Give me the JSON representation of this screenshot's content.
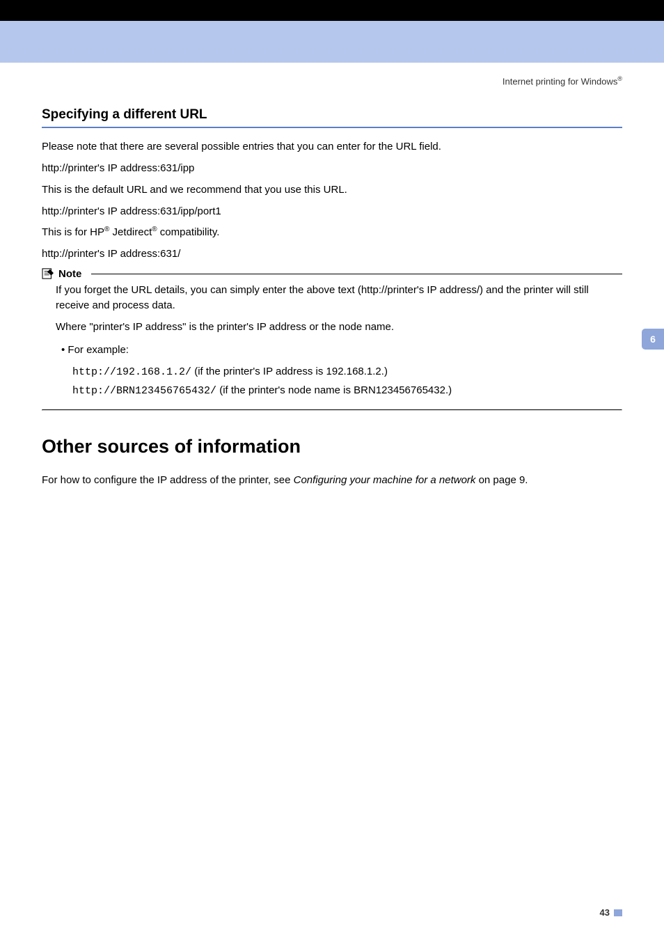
{
  "header": {
    "text": "Internet printing for Windows",
    "sup": "®"
  },
  "section": {
    "title": "Specifying a different URL",
    "p1": "Please note that there are several possible entries that you can enter for the URL field.",
    "p2": "http://printer's IP address:631/ipp",
    "p3": "This is the default URL and we recommend that you use this URL.",
    "p4": "http://printer's IP address:631/ipp/port1",
    "p5_pre": "This is for HP",
    "p5_sup1": "®",
    "p5_mid": " Jetdirect",
    "p5_sup2": "®",
    "p5_post": " compatibility.",
    "p6": "http://printer's IP address:631/"
  },
  "note": {
    "label": "Note",
    "p1": "If you forget the URL details, you can simply enter the above text (http://printer's IP address/) and the printer will still receive and process data.",
    "p2": "Where \"printer's IP address\" is the printer's IP address or the node name.",
    "bullet": "For example:",
    "ex1_code": "http://192.168.1.2/",
    "ex1_tail": "  (if the printer's IP address is 192.168.1.2.)",
    "ex2_code": "http://BRN123456765432/",
    "ex2_tail": "  (if the printer's node name is BRN123456765432.)"
  },
  "other": {
    "title": "Other sources of information",
    "pre": "For how to configure the IP address of the printer, see ",
    "link": "Configuring your machine for a network",
    "post": " on page 9."
  },
  "sidebar": {
    "chapter": "6"
  },
  "footer": {
    "page": "43"
  }
}
